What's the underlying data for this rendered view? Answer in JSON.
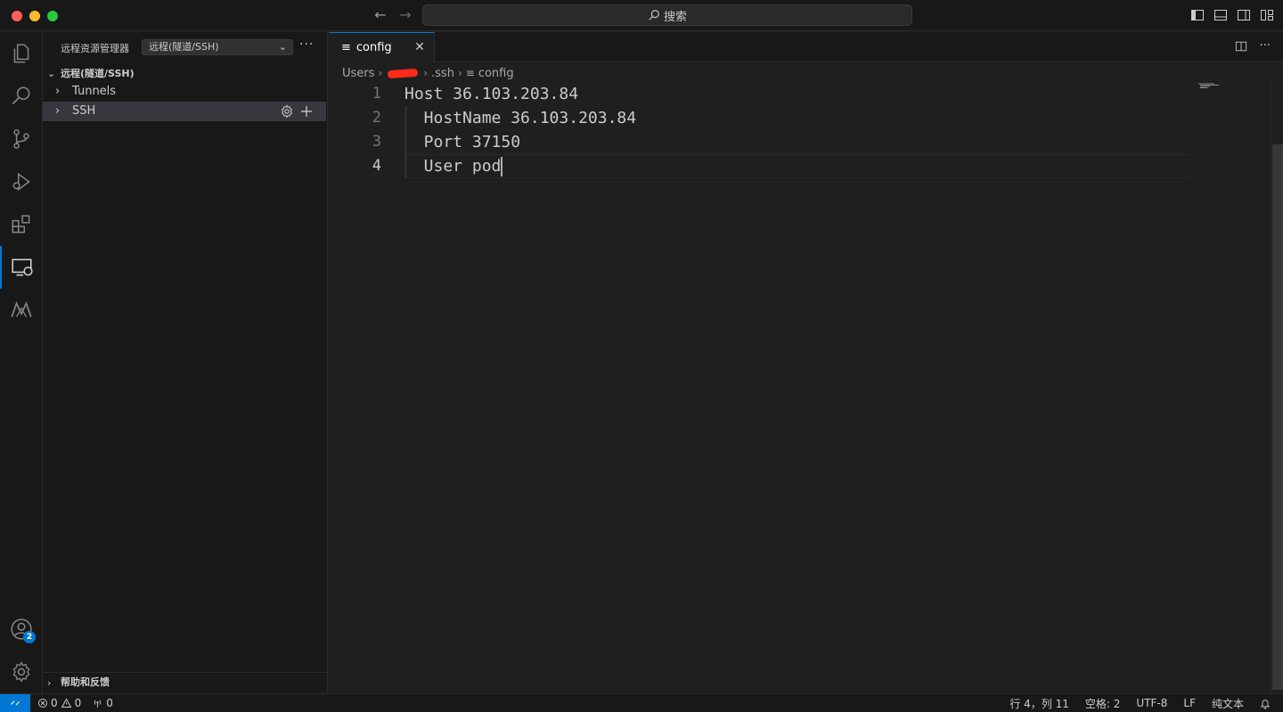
{
  "titlebar": {
    "search_icon": "search-icon",
    "search_label": "搜索"
  },
  "sidebar": {
    "title": "远程资源管理器",
    "select_value": "远程(隧道/SSH)",
    "section_title": "远程(隧道/SSH)",
    "items": [
      {
        "label": "Tunnels"
      },
      {
        "label": "SSH"
      }
    ],
    "footer_label": "帮助和反馈"
  },
  "tabs": [
    {
      "label": "config",
      "icon": "lines-icon"
    }
  ],
  "breadcrumb": {
    "parts": [
      "Users",
      ".ssh",
      "config"
    ]
  },
  "editor": {
    "lines": [
      {
        "num": "1",
        "text": "Host 36.103.203.84"
      },
      {
        "num": "2",
        "text": "  HostName 36.103.203.84"
      },
      {
        "num": "3",
        "text": "  Port 37150"
      },
      {
        "num": "4",
        "text": "  User pod"
      }
    ],
    "current_line": 4
  },
  "activity": {
    "account_badge": "2"
  },
  "statusbar": {
    "errors": "0",
    "warnings": "0",
    "ports": "0",
    "position": "行 4，列 11",
    "spaces": "空格: 2",
    "encoding": "UTF-8",
    "eol": "LF",
    "language": "纯文本"
  },
  "colors": {
    "accent": "#0078d4",
    "background": "#1f1f1f",
    "sidebar": "#181818"
  }
}
